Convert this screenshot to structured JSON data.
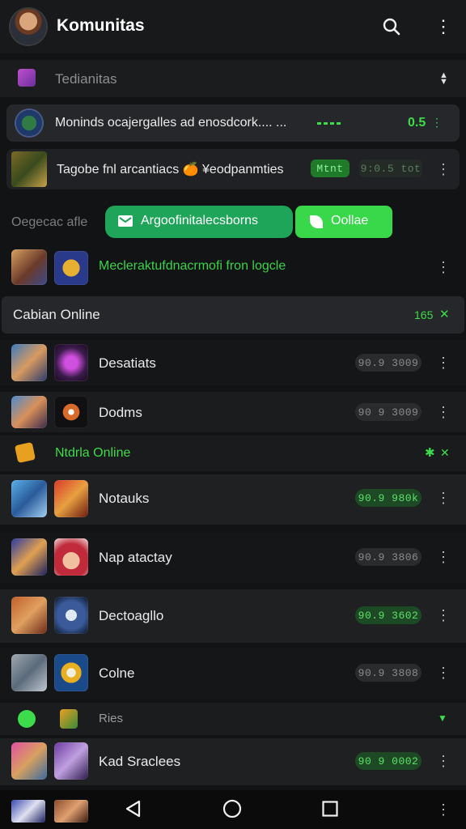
{
  "header": {
    "title": "Komunitas"
  },
  "filter_row": {
    "label": "Tedianitas"
  },
  "info_row_1": {
    "text": "Moninds ocajergalles ad enosdcork.... ...",
    "value": "0.5"
  },
  "info_row_2": {
    "text": "Tagobe fnl arcantiacs 🍊 ¥eodpanmties",
    "badge": "Mtnt",
    "value": "9:0.5 tot"
  },
  "actions": {
    "left_label": "Oegecac afle",
    "primary_label": "Argoofinitalecsborns",
    "secondary_label": "Oollae"
  },
  "highlight_row": {
    "text": "Mecleraktufdnacrmofi fron logcle"
  },
  "section_1": {
    "title": "Cabian Online",
    "count": "165",
    "members": [
      {
        "name": "Desatiats",
        "badge": "90.9 3009",
        "badge_state": "gray"
      },
      {
        "name": "Dodms",
        "badge": "90 9 3009",
        "badge_state": "gray"
      }
    ]
  },
  "section_2": {
    "title": "Ntdrla Online",
    "members": [
      {
        "name": "Notauks",
        "badge": "90.9 980k",
        "badge_state": "green"
      },
      {
        "name": "Nap atactay",
        "badge": "90.9 3806",
        "badge_state": "gray"
      },
      {
        "name": "Dectoagllo",
        "badge": "90.9 3602",
        "badge_state": "green"
      },
      {
        "name": "Colne",
        "badge": "90.9 3808",
        "badge_state": "gray"
      }
    ]
  },
  "section_3": {
    "title": "Ries",
    "members": [
      {
        "name": "Kad Sraclees",
        "badge": "90 9 0002",
        "badge_state": "green"
      }
    ]
  },
  "colors": {
    "accent": "#3ddc4a",
    "accent_dark": "#1fa646",
    "background": "#121314"
  },
  "icons": {
    "search": "search-icon",
    "more": "more-vert-icon",
    "nav_back": "triangle-back-icon",
    "nav_home": "circle-home-icon",
    "nav_recent": "square-recent-icon"
  }
}
